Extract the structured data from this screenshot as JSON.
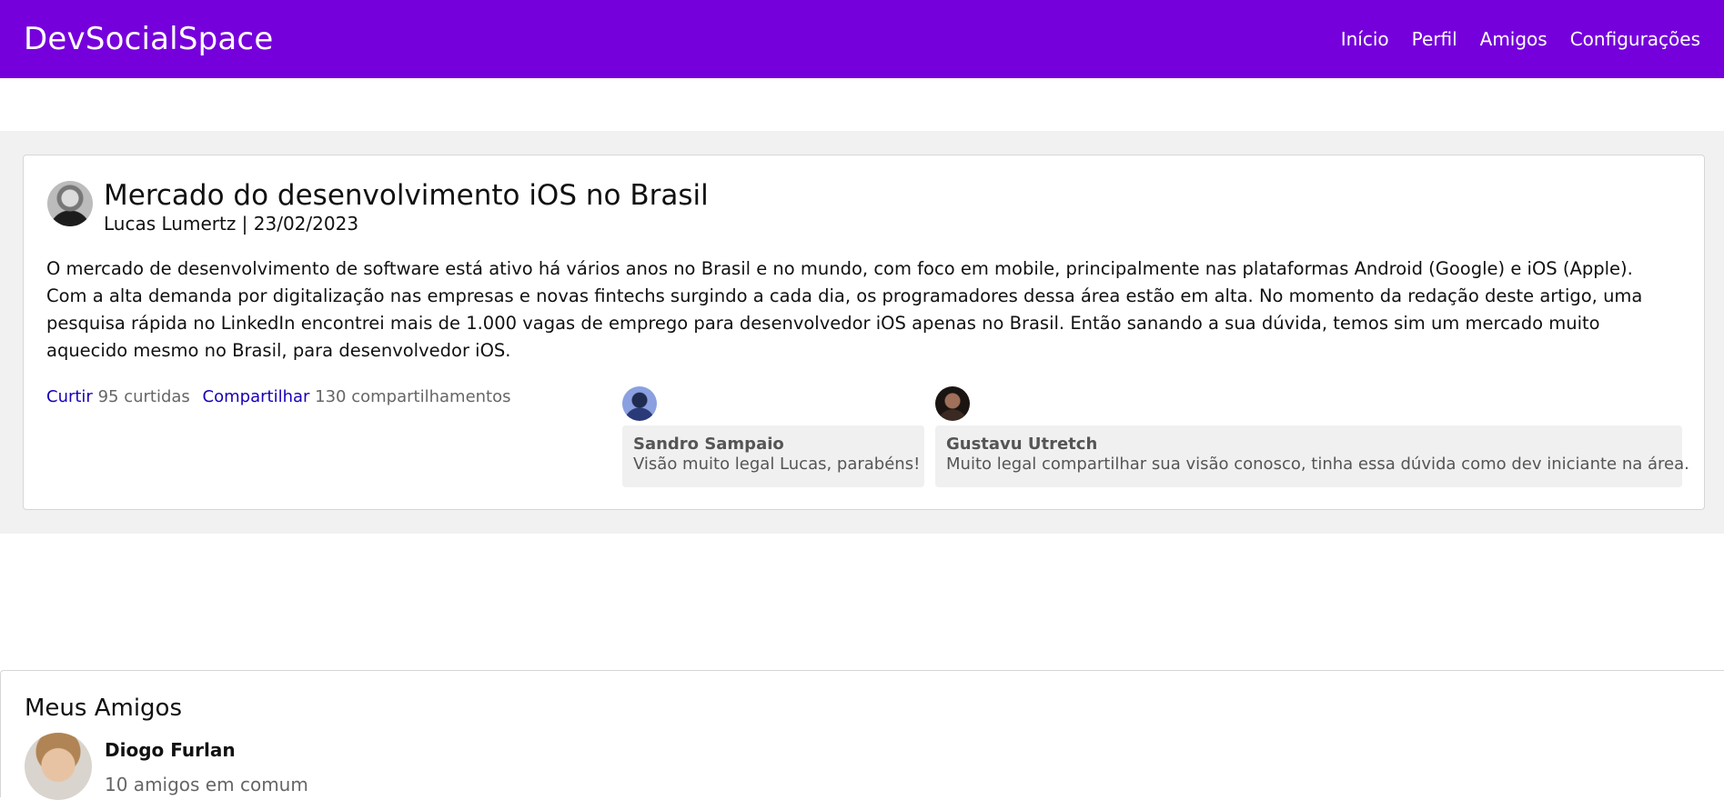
{
  "navbar": {
    "brand": "DevSocialSpace",
    "links": [
      "Início",
      "Perfil",
      "Amigos",
      "Configurações"
    ]
  },
  "post": {
    "title": "Mercado do desenvolvimento iOS no Brasil",
    "meta": "Lucas Lumertz | 23/02/2023",
    "body": "O mercado de desenvolvimento de software está ativo há vários anos no Brasil e no mundo, com foco em mobile, principalmente nas plataformas Android (Google) e iOS (Apple). Com a alta demanda por digitalização nas empresas e novas fintechs surgindo a cada dia, os programadores dessa área estão em alta. No momento da redação deste artigo, uma pesquisa rápida no LinkedIn encontrei mais de 1.000 vagas de emprego para desenvolvedor iOS apenas no Brasil. Então sanando a sua dúvida, temos sim um mercado muito aquecido mesmo no Brasil, para desenvolvedor iOS.",
    "like_label": "Curtir",
    "like_count": "95 curtidas",
    "share_label": "Compartilhar",
    "share_count": "130 compartilhamentos",
    "comments": [
      {
        "author": "Sandro Sampaio",
        "text": "Visão muito legal Lucas, parabéns!"
      },
      {
        "author": "Gustavu Utretch",
        "text": "Muito legal compartilhar sua visão conosco, tinha essa dúvida como dev iniciante na área."
      }
    ]
  },
  "friends": {
    "heading": "Meus Amigos",
    "items": [
      {
        "name": "Diogo Furlan",
        "mutual": "10 amigos em comum"
      }
    ]
  },
  "colors": {
    "navbar_bg": "#7600dc",
    "link": "#1700b8",
    "feed_bg": "#f1f1f1"
  }
}
